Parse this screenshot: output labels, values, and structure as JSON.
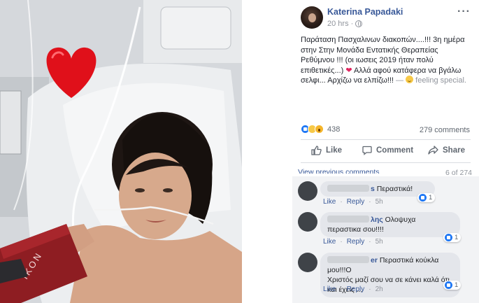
{
  "post": {
    "author": "Katerina Papadaki",
    "time": "20 hrs",
    "privacy_icon": "globe-icon",
    "text_main": "Παράταση Πασχαλινων διακοπών....!!! 3η ημέρα στην Στην Μονάδα Εντατικής Θεραπείας Ρεθύμνου !!! (οι ιωσεις 2019 ήταν πολύ επιθετικές...)",
    "text_heart": "❤",
    "text_rest": "Αλλά αφού κατάφερα να βγάλω σελφι... Αρχίζω να ελπίζω!!!",
    "text_dash": "—",
    "feeling": "feeling special."
  },
  "stats": {
    "reactions_count": "438",
    "reaction_icons": [
      "like-icon",
      "sad-icon",
      "wow-icon"
    ],
    "comments_count": "279 comments"
  },
  "actions": {
    "like": "Like",
    "comment": "Comment",
    "share": "Share"
  },
  "comments_header": {
    "view_previous": "View previous comments",
    "page": "6 of 274"
  },
  "comments": [
    {
      "name_fragment": "s",
      "text": "Περαστικά!",
      "like": "Like",
      "reply": "Reply",
      "time": "5h",
      "reactions": "1"
    },
    {
      "name_fragment": "λης",
      "text_inline": "Ολοψυχα",
      "text": "περαστικα σου!!!!",
      "like": "Like",
      "reply": "Reply",
      "time": "5h",
      "reactions": "1"
    },
    {
      "name_fragment": "er",
      "text_inline": "Περαστικά κούκλα μου!!!Ο",
      "text": "Χριστός μαζί σου να σε κάνει καλά ότι και έχεις ...",
      "like": "Like",
      "reply": "Reply",
      "time": "2h",
      "reactions": "1"
    }
  ],
  "photo": {
    "band_text": "ΙΚΟΝ",
    "heart_color": "#e0101a"
  },
  "colors": {
    "link": "#385898",
    "muted": "#90949c",
    "accent_like": "#2078f4"
  }
}
